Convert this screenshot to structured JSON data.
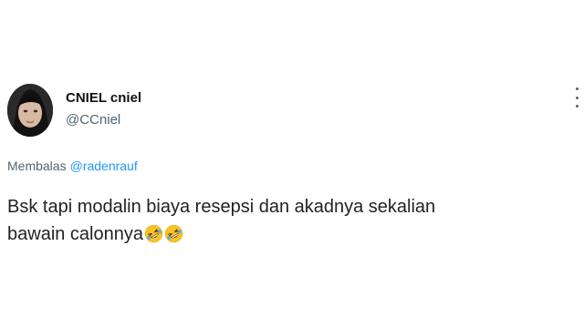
{
  "author": {
    "display_name": "CNIEL cniel",
    "handle": "@CCniel"
  },
  "reply": {
    "prefix": "Membalas",
    "mention": "@radenrauf"
  },
  "tweet": {
    "line1": "Bsk tapi modalin biaya resepsi dan akadnya sekalian",
    "line2": "bawain calonnya",
    "emojis": [
      "rolling-on-the-floor-laughing",
      "rolling-on-the-floor-laughing"
    ]
  },
  "icons": {
    "more": "more-vertical-icon"
  },
  "colors": {
    "mention": "#1d9bf0",
    "secondary_text": "#536471",
    "emoji_face": "#f9c423"
  }
}
